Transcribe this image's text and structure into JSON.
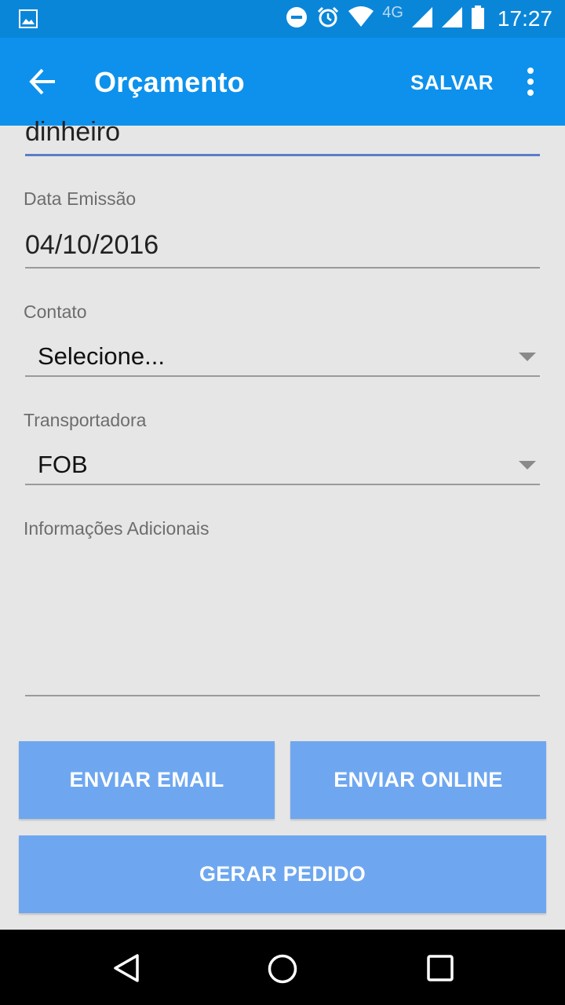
{
  "status_bar": {
    "network_label": "4G",
    "time": "17:27",
    "icons": [
      "image-icon",
      "do-not-disturb-icon",
      "alarm-icon",
      "wifi-icon",
      "signal-icon",
      "signal-icon",
      "battery-icon"
    ]
  },
  "app_bar": {
    "title": "Orçamento",
    "save_label": "SALVAR",
    "back_icon": "arrow-back-icon",
    "more_icon": "more-vert-icon",
    "color": "#0d91ec"
  },
  "form": {
    "payment_value": "dinheiro",
    "emission_date": {
      "label": "Data Emissão",
      "value": "04/10/2016"
    },
    "contact": {
      "label": "Contato",
      "selected": "Selecione..."
    },
    "carrier": {
      "label": "Transportadora",
      "selected": "FOB"
    },
    "additional_info": {
      "label": "Informações Adicionais",
      "value": ""
    }
  },
  "buttons": {
    "send_email": "ENVIAR EMAIL",
    "send_online": "ENVIAR ONLINE",
    "generate_order": "GERAR PEDIDO",
    "color": "#6ea7f0"
  },
  "nav_bar": {
    "icons": [
      "back-triangle-icon",
      "home-circle-icon",
      "recents-square-icon"
    ]
  }
}
